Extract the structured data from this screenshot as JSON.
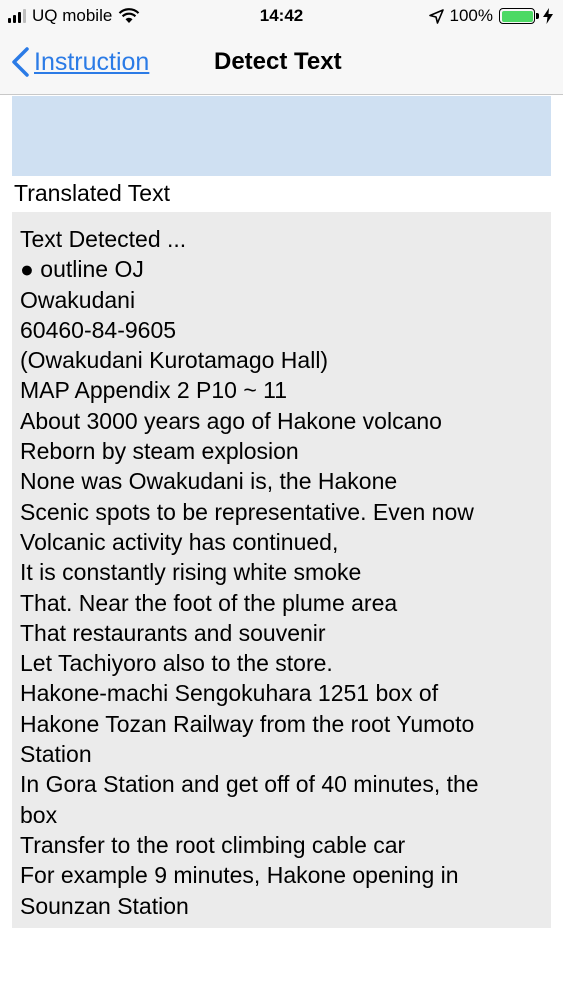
{
  "status_bar": {
    "carrier": "UQ mobile",
    "time": "14:42",
    "battery": "100%",
    "battery_color": "#4cd964"
  },
  "nav": {
    "back_label": "Instruction",
    "title": "Detect Text",
    "back_icon": "chevron-left-icon"
  },
  "translated_section": {
    "label": "Translated Text",
    "lines": [
      "Text Detected ...",
      "● outline OJ",
      "Owakudani",
      "60460-84-9605",
      "(Owakudani Kurotamago Hall)",
      "MAP Appendix 2 P10 ~ 11",
      "About 3000 years ago of Hakone volcano",
      "Reborn by steam explosion",
      "None was Owakudani is, the Hakone",
      "Scenic spots to be representative. Even now",
      "Volcanic activity has continued,",
      "It is constantly rising white smoke",
      "That. Near the foot of the plume area",
      "That restaurants and souvenir",
      "Let Tachiyoro also to the store.",
      "Hakone-machi Sengokuhara 1251 box of",
      "Hakone Tozan Railway from the root Yumoto",
      "Station",
      "In Gora Station and get off of 40 minutes, the",
      "box",
      "Transfer to the root climbing cable car",
      "For example 9 minutes, Hakone opening in",
      "Sounzan Station"
    ]
  },
  "colors": {
    "accent": "#2b7be6",
    "detected_box": "#cfe0f2",
    "translated_box": "#ebebeb"
  }
}
